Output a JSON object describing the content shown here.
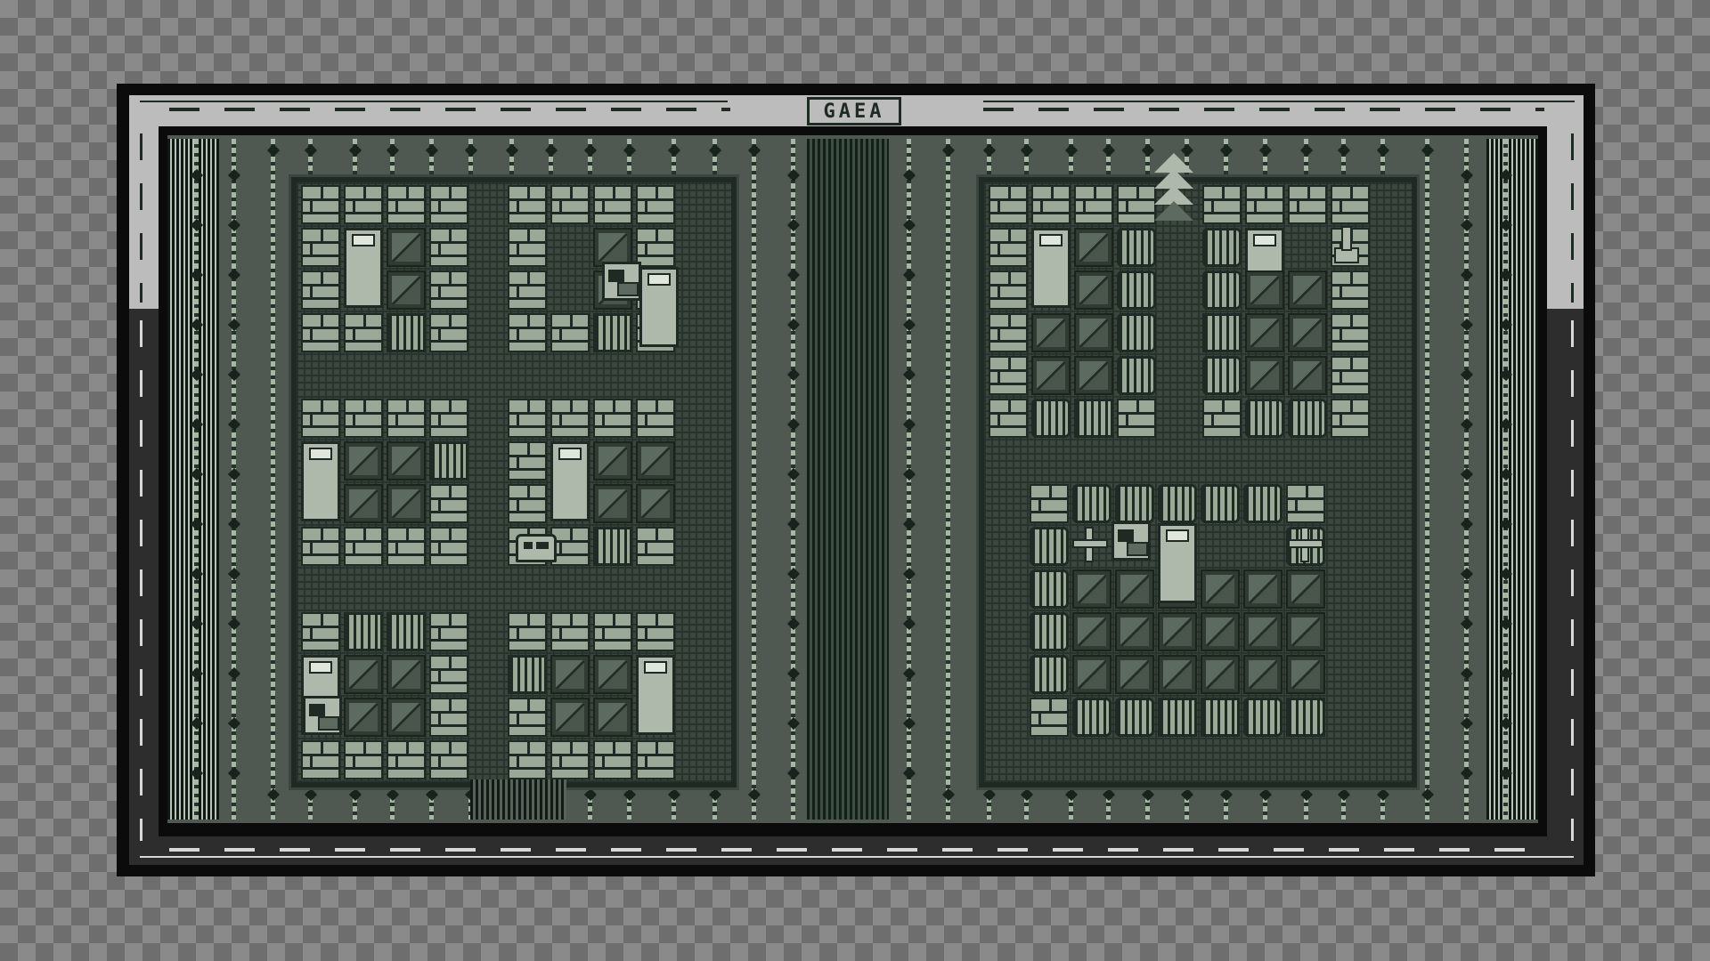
{
  "title": "GAEA",
  "palette": {
    "darkest": "#0b0b0b",
    "dark_green": "#1e2a23",
    "mid_green": "#4f5951",
    "light_green": "#9aa897",
    "highlight": "#aeb9ab",
    "frame_light": "#bcbcbc",
    "frame_dark": "#2d2d2d"
  },
  "sprites": {
    "player": "robot-sprite",
    "tree": "pixel-tree",
    "grave": "tombstone-icon",
    "console": "terminal-console",
    "bed": "bed-tile",
    "crate": "crate-tile",
    "barrel": "barrel-tile"
  }
}
